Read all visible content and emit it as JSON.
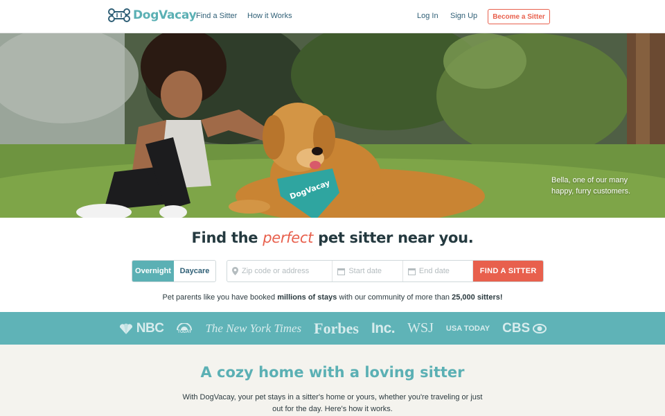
{
  "header": {
    "logo_text": "DogVacay",
    "nav": [
      "Find a Sitter",
      "How it Works"
    ],
    "login": "Log In",
    "signup": "Sign Up",
    "become_sitter": "Become a Sitter"
  },
  "hero": {
    "caption": "Bella, one of our many happy, furry customers.",
    "bandana_text": "DogVacay"
  },
  "search": {
    "headline_before": "Find the",
    "headline_accent": "perfect",
    "headline_after": "pet sitter near you.",
    "toggle": [
      "Overnight",
      "Daycare"
    ],
    "toggle_active": "Overnight",
    "zip_placeholder": "Zip code or address",
    "start_placeholder": "Start date",
    "end_placeholder": "End date",
    "find_button": "FIND A SITTER"
  },
  "stats": {
    "prefix": "Pet parents like you have booked",
    "bold1": "millions of stays",
    "middle": "with our community of more than",
    "bold2": "25,000 sitters!"
  },
  "press": {
    "logos": [
      "NBC",
      "TODAY",
      "The New York Times",
      "Forbes",
      "Inc.",
      "WSJ",
      "USA TODAY",
      "CBS"
    ]
  },
  "cozy": {
    "title": "A cozy home with a loving sitter",
    "text": "With DogVacay, your pet stays in a sitter's home or yours, whether you're traveling or just out for the day. Here's how it works."
  },
  "colors": {
    "teal": "#5bb0b4",
    "coral": "#e8604d",
    "navy": "#2f5f76",
    "cream": "#f4f3ee"
  }
}
